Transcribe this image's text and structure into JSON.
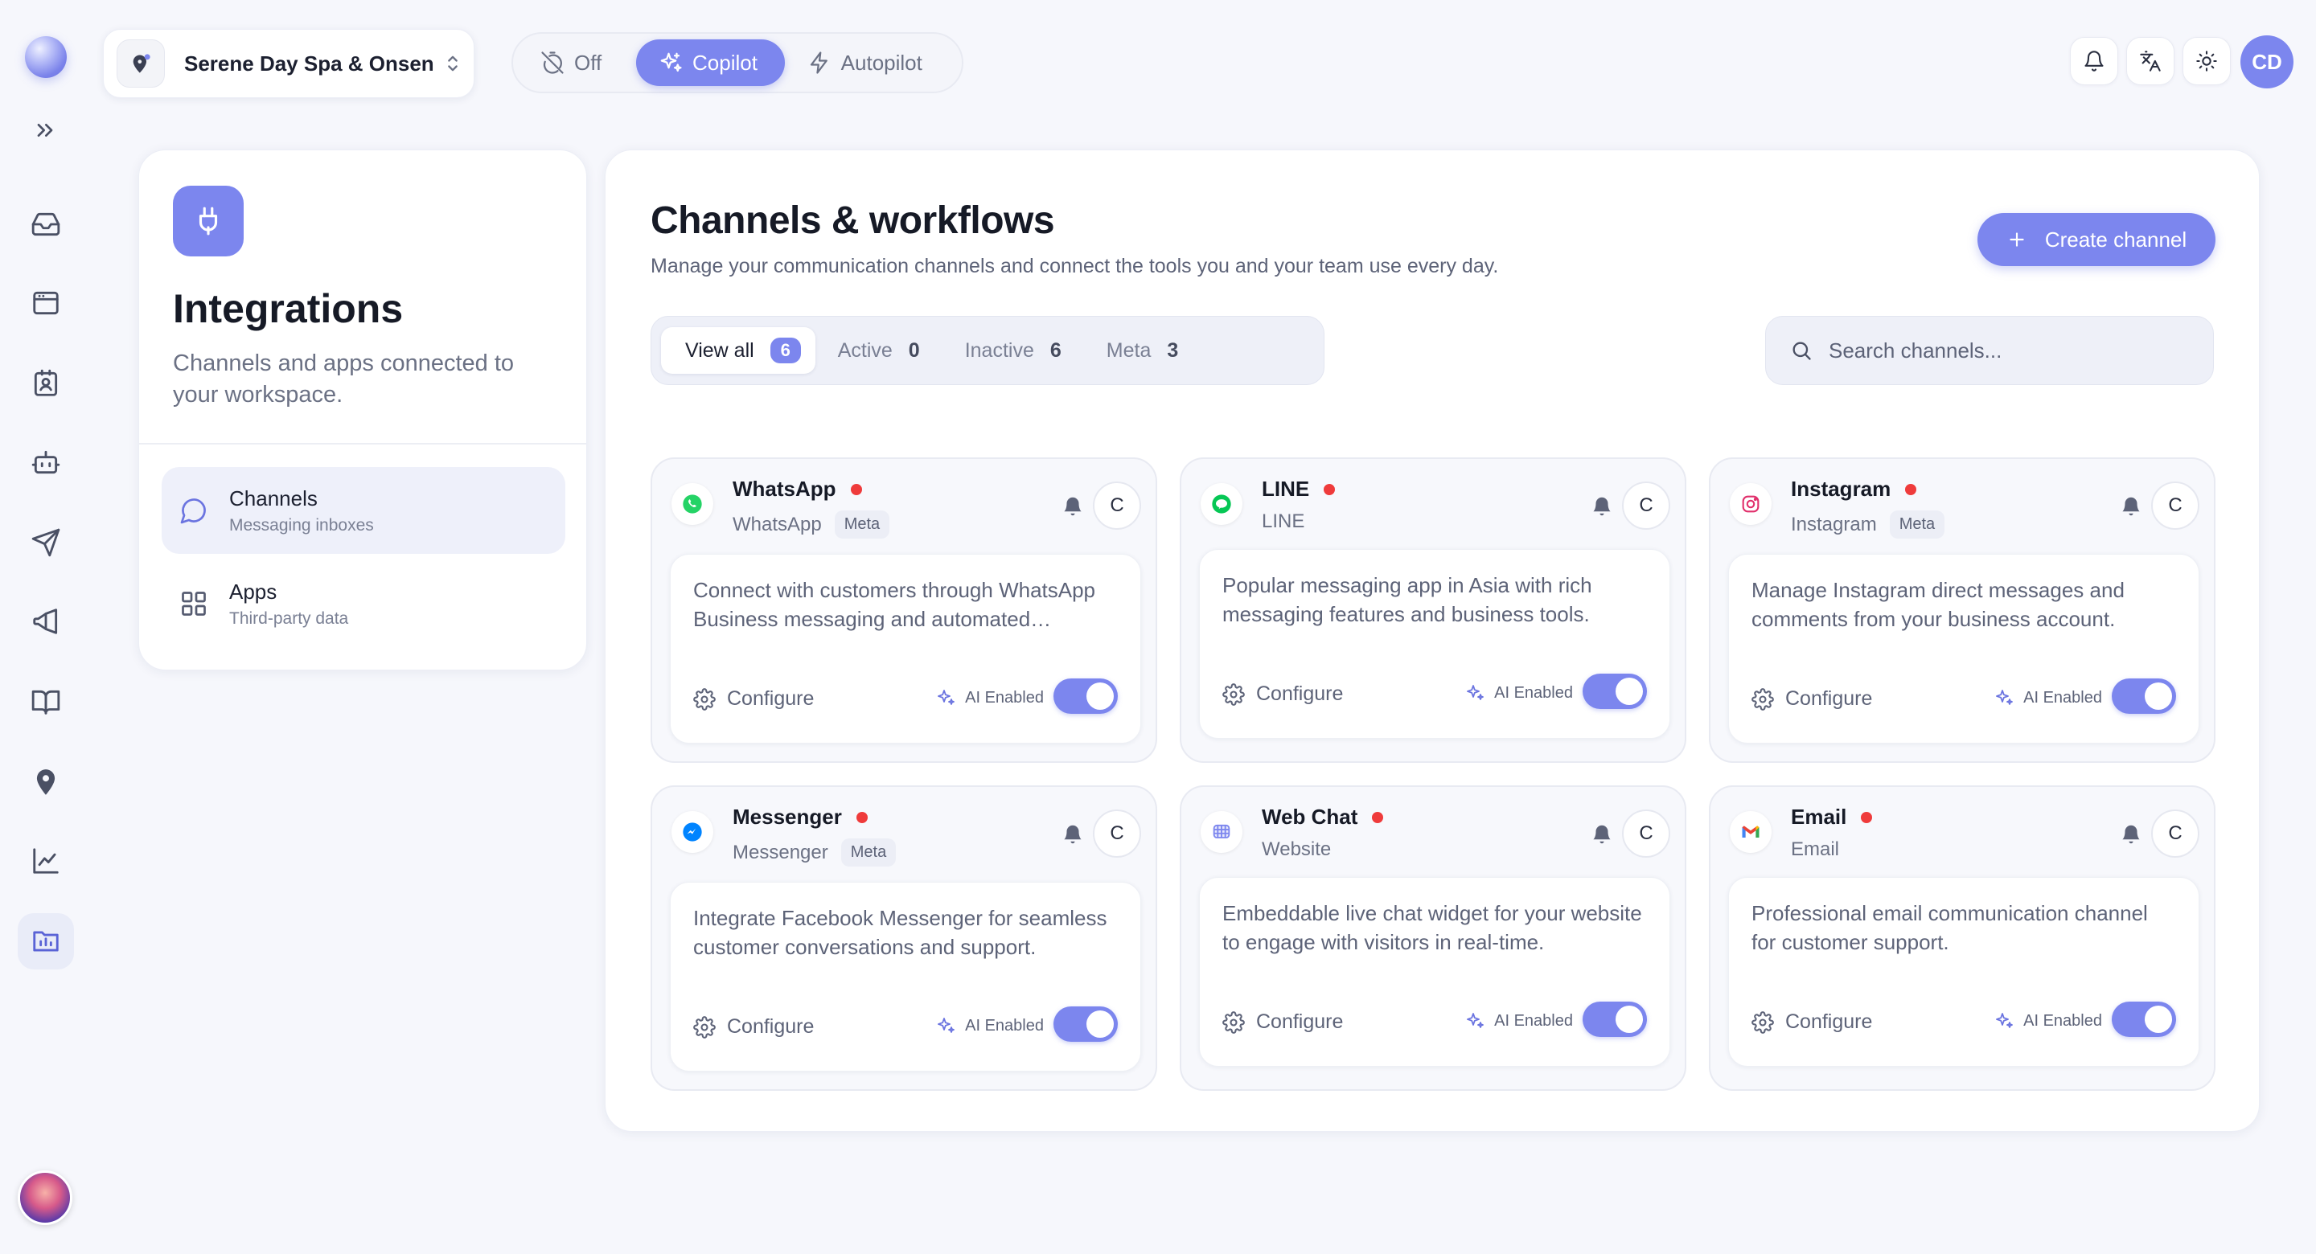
{
  "workspace": {
    "name": "Serene Day Spa & Onsen"
  },
  "modes": [
    {
      "label": "Off",
      "active": false
    },
    {
      "label": "Copilot",
      "active": true
    },
    {
      "label": "Autopilot",
      "active": false
    }
  ],
  "user": {
    "initials": "CD"
  },
  "rail": {
    "active": "insights"
  },
  "integrations": {
    "title": "Integrations",
    "subtitle": "Channels and apps connected to your workspace.",
    "nav": [
      {
        "title": "Channels",
        "desc": "Messaging inboxes",
        "active": true
      },
      {
        "title": "Apps",
        "desc": "Third-party data",
        "active": false
      }
    ]
  },
  "main": {
    "title": "Channels & workflows",
    "subtitle": "Manage your communication channels and connect the tools you and your team use every day.",
    "create_label": "Create channel",
    "filters": [
      {
        "label": "View all",
        "count": "6",
        "active": true
      },
      {
        "label": "Active",
        "count": "0",
        "active": false
      },
      {
        "label": "Inactive",
        "count": "6",
        "active": false
      },
      {
        "label": "Meta",
        "count": "3",
        "active": false
      }
    ],
    "search_placeholder": "Search channels..."
  },
  "card_labels": {
    "configure": "Configure",
    "ai": "AI Enabled",
    "assignee": "C"
  },
  "channels": [
    {
      "name": "WhatsApp",
      "type": "WhatsApp",
      "badge": "Meta",
      "desc": "Connect with customers through WhatsApp Business messaging and automated responses.",
      "icon": "whatsapp-icon",
      "color": "#25d366",
      "status_color": "#ef3b3b",
      "ai_enabled": true
    },
    {
      "name": "LINE",
      "type": "LINE",
      "badge": "",
      "desc": "Popular messaging app in Asia with rich messaging features and business tools.",
      "icon": "line-icon",
      "color": "#06c755",
      "status_color": "#ef3b3b",
      "ai_enabled": true
    },
    {
      "name": "Instagram",
      "type": "Instagram",
      "badge": "Meta",
      "desc": "Manage Instagram direct messages and comments from your business account.",
      "icon": "instagram-icon",
      "color": "#e1306c",
      "status_color": "#ef3b3b",
      "ai_enabled": true
    },
    {
      "name": "Messenger",
      "type": "Messenger",
      "badge": "Meta",
      "desc": "Integrate Facebook Messenger for seamless customer conversations and support.",
      "icon": "messenger-icon",
      "color": "#0084ff",
      "status_color": "#ef3b3b",
      "ai_enabled": true
    },
    {
      "name": "Web Chat",
      "type": "Website",
      "badge": "",
      "desc": "Embeddable live chat widget for your website to engage with visitors in real-time.",
      "icon": "webchat-icon",
      "color": "#7c86ee",
      "status_color": "#ef3b3b",
      "ai_enabled": true
    },
    {
      "name": "Email",
      "type": "Email",
      "badge": "",
      "desc": "Professional email communication channel for customer support.",
      "icon": "gmail-icon",
      "color": "#ea4335",
      "status_color": "#ef3b3b",
      "ai_enabled": true
    }
  ]
}
